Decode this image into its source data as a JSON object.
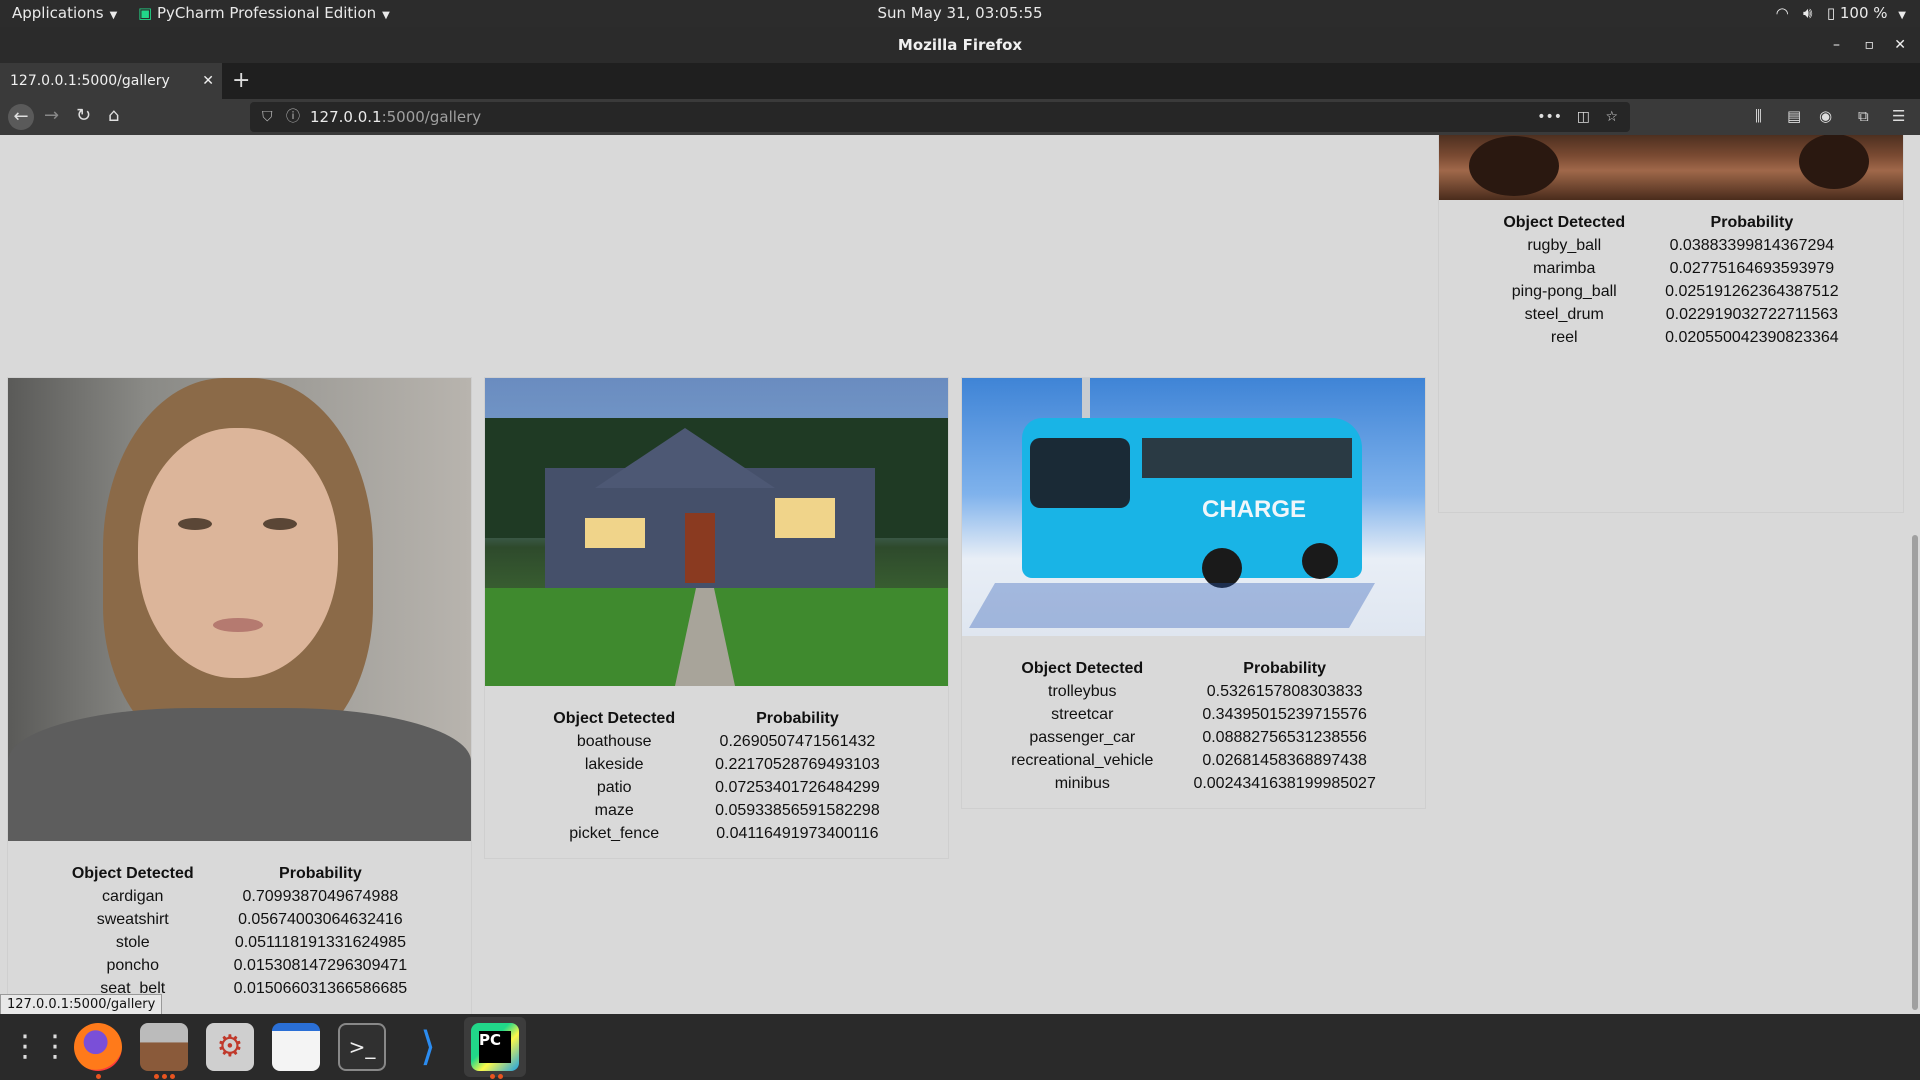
{
  "topbar": {
    "applications": "Applications",
    "active_app": "PyCharm Professional Edition",
    "clock": "Sun May 31, 03:05:55",
    "battery": "100 %"
  },
  "window": {
    "title": "Mozilla Firefox"
  },
  "tabs": [
    {
      "label": "127.0.0.1:5000/gallery"
    }
  ],
  "urlbar": {
    "host": "127.0.0.1",
    "path": ":5000/gallery"
  },
  "status_link": "127.0.0.1:5000/gallery",
  "gallery": {
    "headers": {
      "object": "Object Detected",
      "probability": "Probability"
    },
    "cards": [
      {
        "image": "arms-crossed-photo",
        "rows": [
          {
            "object": "rugby_ball",
            "probability": "0.03883399814367294"
          },
          {
            "object": "marimba",
            "probability": "0.02775164693593979"
          },
          {
            "object": "ping-pong_ball",
            "probability": "0.025191262364387512"
          },
          {
            "object": "steel_drum",
            "probability": "0.022919032722711563"
          },
          {
            "object": "reel",
            "probability": "0.020550042390823364"
          }
        ]
      },
      {
        "image": "woman-portrait-photo",
        "rows": [
          {
            "object": "cardigan",
            "probability": "0.7099387049674988"
          },
          {
            "object": "sweatshirt",
            "probability": "0.05674003064632416"
          },
          {
            "object": "stole",
            "probability": "0.051118191331624985"
          },
          {
            "object": "poncho",
            "probability": "0.015308147296309471"
          },
          {
            "object": "seat_belt",
            "probability": "0.015066031366586685"
          }
        ]
      },
      {
        "image": "house-photo",
        "rows": [
          {
            "object": "boathouse",
            "probability": "0.2690507471561432"
          },
          {
            "object": "lakeside",
            "probability": "0.22170528769493103"
          },
          {
            "object": "patio",
            "probability": "0.07253401726484299"
          },
          {
            "object": "maze",
            "probability": "0.05933856591582298"
          },
          {
            "object": "picket_fence",
            "probability": "0.04116491973400116"
          }
        ]
      },
      {
        "image": "trolleybus-photo",
        "bus_text": "CHARGE",
        "rows": [
          {
            "object": "trolleybus",
            "probability": "0.5326157808303833"
          },
          {
            "object": "streetcar",
            "probability": "0.34395015239715576"
          },
          {
            "object": "passenger_car",
            "probability": "0.08882756531238556"
          },
          {
            "object": "recreational_vehicle",
            "probability": "0.02681458368897438"
          },
          {
            "object": "minibus",
            "probability": "0.0024341638199985027"
          }
        ]
      }
    ]
  },
  "dock": [
    {
      "name": "show-apps-icon"
    },
    {
      "name": "firefox-icon"
    },
    {
      "name": "archive-manager-icon"
    },
    {
      "name": "settings-tools-icon"
    },
    {
      "name": "text-editor-icon"
    },
    {
      "name": "terminal-icon"
    },
    {
      "name": "vscode-icon"
    },
    {
      "name": "pycharm-icon",
      "label": "PC"
    }
  ],
  "colors": {
    "dock_accent": "#e95420",
    "bus": "#19b4e6",
    "page_bg": "#d9d9d9"
  }
}
